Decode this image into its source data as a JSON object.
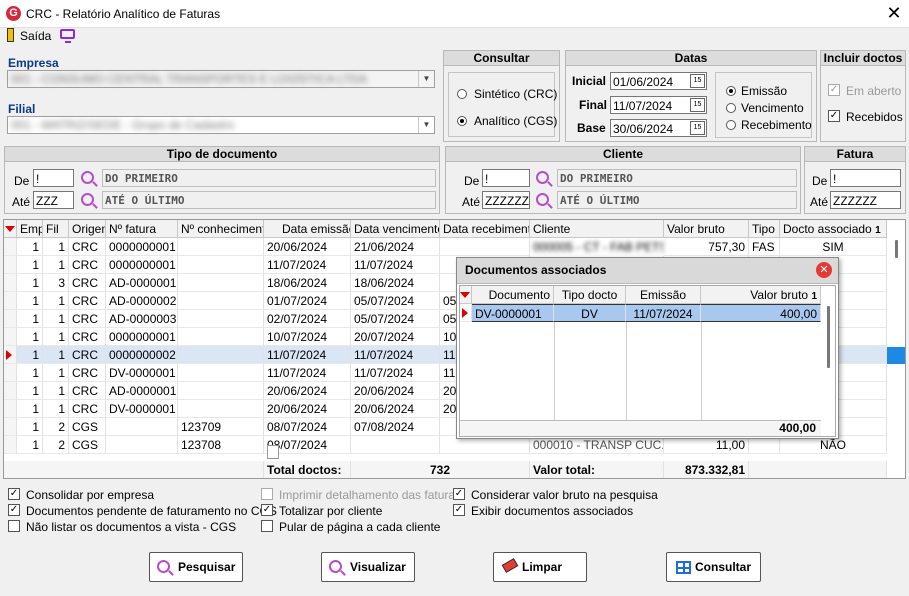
{
  "window": {
    "title": "CRC - Relatório Analítico de Faturas",
    "logo": "G",
    "close": "✕"
  },
  "toolbar": {
    "exit_label": "Saída"
  },
  "empresa": {
    "label": "Empresa",
    "value": "001 - CONSUMO CENTRAL TRANSPORTES E LOGÍSTICA LTDA"
  },
  "filial": {
    "label": "Filial",
    "value": "001 - MATRIZ/SEDE - Grupo de Cadastro"
  },
  "consultar": {
    "title": "Consultar",
    "options": [
      "Sintético (CRC)",
      "Analítico (CGS)"
    ],
    "selected": 1
  },
  "datas": {
    "title": "Datas",
    "inicial_label": "Inicial",
    "inicial": "01/06/2024",
    "final_label": "Final",
    "final": "11/07/2024",
    "base_label": "Base",
    "base": "30/06/2024",
    "date_btn": "15",
    "options": [
      "Emissão",
      "Vencimento",
      "Recebimento"
    ],
    "selected": 0
  },
  "incluir": {
    "title": "Incluir doctos",
    "em_aberto": "Em aberto",
    "recebidos": "Recebidos",
    "check_mark": "✓"
  },
  "tipo_doc": {
    "title": "Tipo de documento",
    "de_label": "De",
    "de_value": "!",
    "ate_label": "Até",
    "ate_value": "ZZZ",
    "de_desc": "DO PRIMEIRO",
    "ate_desc": "ATÉ O ÚLTIMO"
  },
  "cliente": {
    "title": "Cliente",
    "de_label": "De",
    "de_value": "!",
    "ate_label": "Até",
    "ate_value": "ZZZZZZ",
    "de_desc": "DO PRIMEIRO",
    "ate_desc": "ATÉ O ÚLTIMO"
  },
  "fatura": {
    "title": "Fatura",
    "de_label": "De",
    "de_value": "!",
    "ate_label": "Até",
    "ate_value": "ZZZZZZ"
  },
  "grid": {
    "headers": [
      "Emp",
      "Fil",
      "Origem",
      "Nº fatura",
      "Nº conhecimento",
      "Data emissão",
      "Data vencimento",
      "Data recebimento",
      "Cliente",
      "Valor bruto",
      "Tipo",
      "Docto associado"
    ],
    "sort_indicator": "1",
    "rows": [
      [
        "1",
        "1",
        "CRC",
        "0000000001",
        "",
        "20/06/2024",
        "21/06/2024",
        "",
        "000005 - CT - FAB PETS",
        "757,30",
        "FAS",
        "SIM"
      ],
      [
        "1",
        "1",
        "CRC",
        "0000000001",
        "",
        "11/07/2024",
        "11/07/2024",
        "",
        "",
        "",
        "",
        ""
      ],
      [
        "1",
        "3",
        "CRC",
        "AD-0000001",
        "",
        "18/06/2024",
        "18/06/2024",
        "",
        "",
        "",
        "",
        ""
      ],
      [
        "1",
        "1",
        "CRC",
        "AD-0000002",
        "",
        "01/07/2024",
        "05/07/2024",
        "05",
        "",
        "",
        "",
        ""
      ],
      [
        "1",
        "1",
        "CRC",
        "AD-0000003",
        "",
        "02/07/2024",
        "05/07/2024",
        "05",
        "",
        "",
        "",
        ""
      ],
      [
        "1",
        "1",
        "CRC",
        "0000000001",
        "",
        "10/07/2024",
        "20/07/2024",
        "10",
        "",
        "",
        "",
        ""
      ],
      [
        "1",
        "1",
        "CRC",
        "0000000002",
        "",
        "11/07/2024",
        "11/07/2024",
        "11",
        "",
        "",
        "",
        ""
      ],
      [
        "1",
        "1",
        "CRC",
        "DV-0000001",
        "",
        "11/07/2024",
        "11/07/2024",
        "11",
        "",
        "",
        "",
        ""
      ],
      [
        "1",
        "1",
        "CRC",
        "AD-0000001",
        "",
        "20/06/2024",
        "20/06/2024",
        "20",
        "",
        "",
        "",
        ""
      ],
      [
        "1",
        "1",
        "CRC",
        "DV-0000001",
        "",
        "20/06/2024",
        "20/06/2024",
        "20",
        "",
        "",
        "",
        ""
      ],
      [
        "1",
        "2",
        "CGS",
        "",
        "123709",
        "08/07/2024",
        "07/08/2024",
        "",
        "",
        "",
        "",
        ""
      ],
      [
        "1",
        "2",
        "CGS",
        "",
        "123708",
        "08/07/2024",
        "",
        "",
        "000010 - TRANSP CUC...",
        "11,00",
        "",
        "NÃO"
      ]
    ],
    "selected_row": 6,
    "total_doctos_label": "Total doctos:",
    "total_doctos": "732",
    "valor_total_label": "Valor total:",
    "valor_total": "873.332,81"
  },
  "popup": {
    "title": "Documentos associados",
    "close": "✕",
    "headers": [
      "Documento",
      "Tipo docto",
      "Emissão",
      "Valor bruto"
    ],
    "sort_indicator": "1",
    "rows": [
      [
        "DV-0000001",
        "DV",
        "11/07/2024",
        "400,00"
      ]
    ],
    "total": "400,00"
  },
  "options": {
    "consolidar": "Consolidar por empresa",
    "pendentes": "Documentos pendente de faturamento no CGS",
    "nao_listar": "Não listar os documentos a vista - CGS",
    "imprimir": "Imprimir detalhamento das faturas",
    "totalizar": "Totalizar por cliente",
    "pular": "Pular de página a cada cliente",
    "considerar": "Considerar valor bruto na pesquisa",
    "exibir": "Exibir documentos associados"
  },
  "buttons": {
    "pesquisar": "Pesquisar",
    "visualizar": "Visualizar",
    "limpar": "Limpar",
    "consultar": "Consultar"
  },
  "colors": {
    "accent": "#0b3a8a",
    "pointer": "#dd0000",
    "search_icon": "#b54fc7"
  }
}
